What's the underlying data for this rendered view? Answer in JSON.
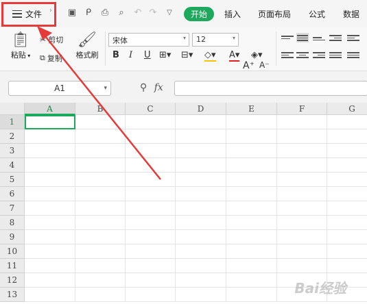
{
  "menubar": {
    "file_label": "文件",
    "tabs": [
      "开始",
      "插入",
      "页面布局",
      "公式",
      "数据"
    ]
  },
  "ribbon": {
    "paste_label": "粘贴",
    "cut_label": "剪切",
    "copy_label": "复制",
    "format_painter_label": "格式刷",
    "font_name": "宋体",
    "font_size": "12",
    "bold": "B",
    "italic": "I",
    "underline": "U",
    "grow_font": "A⁺",
    "shrink_font": "A⁻",
    "font_color_letter": "A"
  },
  "formula_bar": {
    "name_box": "A1",
    "fx_label": "fx",
    "formula": ""
  },
  "grid": {
    "columns": [
      "A",
      "B",
      "C",
      "D",
      "E",
      "F",
      "G"
    ],
    "rows": [
      "1",
      "2",
      "3",
      "4",
      "5",
      "6",
      "7",
      "8",
      "9",
      "10",
      "11",
      "12",
      "13"
    ],
    "selected_cell": "A1"
  },
  "colors": {
    "accent": "#1ea85b",
    "highlight": "#e63a3a"
  },
  "watermark": "Bai经验"
}
